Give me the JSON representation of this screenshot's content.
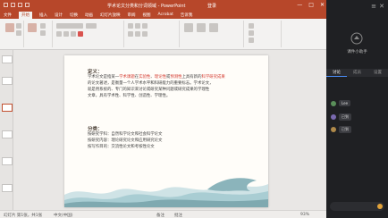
{
  "window": {
    "title": "学术论文分类和分词领域 - PowerPoint",
    "user": "登录",
    "controls": [
      "—",
      "□",
      "✕"
    ]
  },
  "ribbon": {
    "tabs": [
      "文件",
      "开始",
      "插入",
      "设计",
      "切换",
      "动画",
      "幻灯片放映",
      "审阅",
      "视图",
      "Acrobat",
      "告诉我"
    ],
    "active_tab": "开始"
  },
  "slide": {
    "def_heading": "定义：",
    "def_lines": [
      [
        "学术论文是指某一",
        "学术课题",
        "在",
        "实验性",
        "、",
        "理论性",
        "或",
        "预测性",
        "上具有新的",
        "科学研究成果"
      ],
      [
        "的论文著述，是衡量一个人学术水平和科研能力的重要标志。学术论文，"
      ],
      [
        "就是用系统的、专门的知识来讨论或研究某种问题或研究成果的学理性"
      ],
      [
        "文章，具有学术性、科学性、创造性、学理性。"
      ]
    ],
    "cat_heading": "分类：",
    "cat_lines": [
      "按研究学科：自然科学论文和社会科学论文",
      "按研究内容：理论研究论文和应用研究论文",
      "按写作目的：交流性论文和考核性论文"
    ]
  },
  "status": {
    "left": "幻灯片 第1张，共1张",
    "lang": "中文(中国)",
    "notes": "备注",
    "comments": "批注",
    "zoom": "93%"
  },
  "side_panel": {
    "brand": "课件小助手",
    "tabs": [
      "讨论",
      "成员",
      "设置"
    ],
    "active_tab": "讨论",
    "messages": [
      "Lee",
      "已到",
      "已到"
    ]
  },
  "colors": {
    "accent": "#b7472a",
    "highlight": "#d43a2f",
    "panel": "#1f2023"
  }
}
